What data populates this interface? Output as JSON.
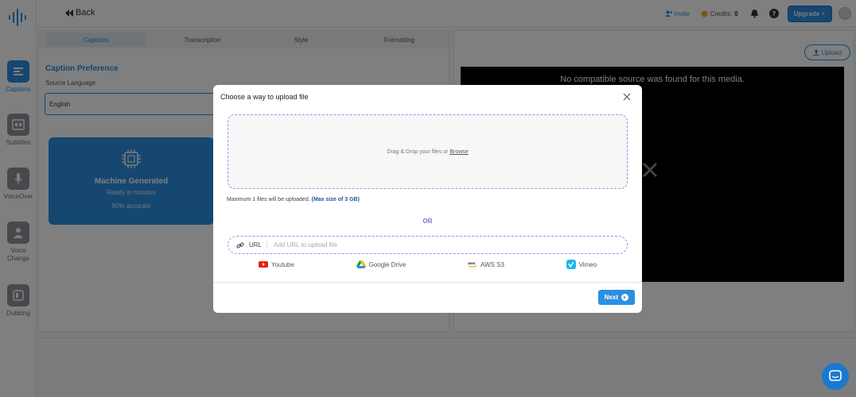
{
  "topbar": {
    "back_label": "Back",
    "invite_label": "Invite",
    "credits_label": "Credits:",
    "credits_value": "0",
    "upgrade_label": "Upgrade"
  },
  "rail": {
    "items": [
      {
        "label": "Captions"
      },
      {
        "label": "Subtitles"
      },
      {
        "label": "VoiceOver"
      },
      {
        "label": "Voice Change"
      },
      {
        "label": "Dubbing"
      }
    ]
  },
  "left": {
    "tabs": [
      "Captions",
      "Transcription",
      "Style",
      "Formatting"
    ],
    "pref_title": "Caption Preference",
    "source_label": "Source Language",
    "source_value": "English",
    "card": {
      "title": "Machine Generated",
      "line1": "Ready in minutes",
      "line2": "80% accurate"
    }
  },
  "right": {
    "upload_label": "Upload",
    "video_message": "No compatible source was found for this media."
  },
  "modal": {
    "title": "Choose a way to upload file",
    "dropzone_text": "Drag & Drop your files or",
    "browse_label": "Browse",
    "max_note": "Maximum 1 files will be uploaded.",
    "max_size": "(Max size of 3 GB)",
    "or_label": "OR",
    "url_label": "URL",
    "url_placeholder": "Add URL to upload file",
    "sources": [
      "Youtube",
      "Google Drive",
      "AWS S3",
      "Vimeo"
    ],
    "next_label": "Next"
  },
  "colors": {
    "accent": "#2b8fe0",
    "dashed_border": "#9b94db",
    "or_color": "#7a74c8"
  }
}
